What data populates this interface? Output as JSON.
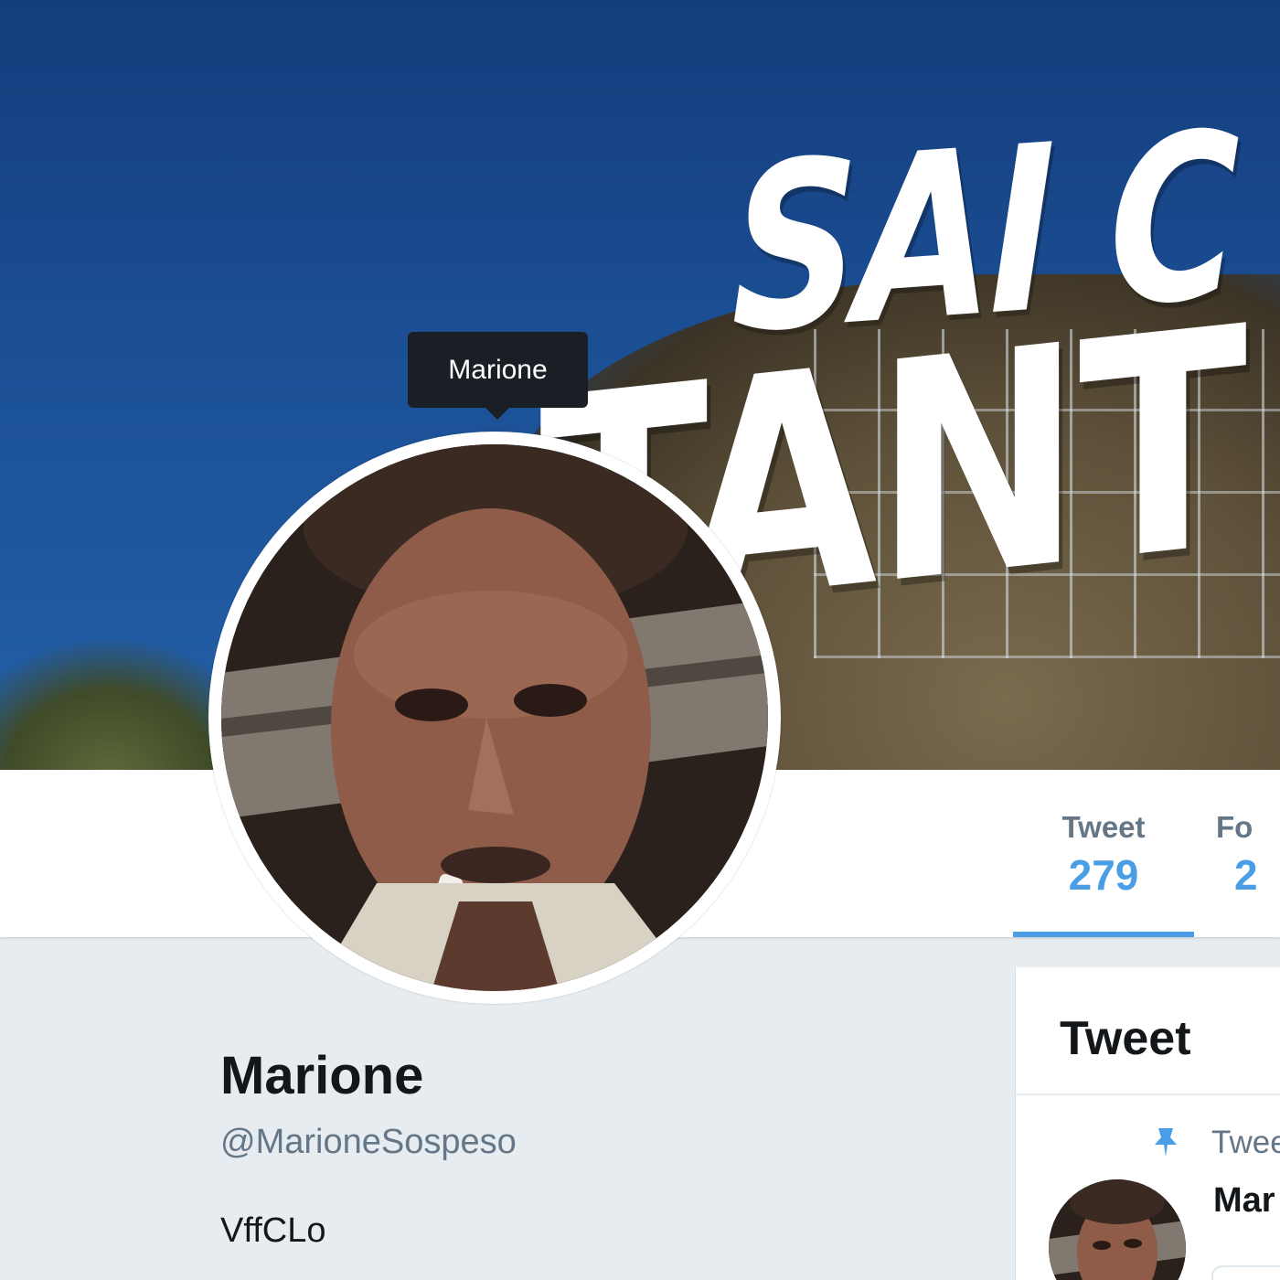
{
  "banner": {
    "line1": "SAI C",
    "line2": "TANT"
  },
  "tooltip": {
    "text": "Marione"
  },
  "stats": {
    "tweets": {
      "label": "Tweet",
      "value": "279",
      "active": true
    },
    "followers": {
      "label": "Fo",
      "value": "2"
    }
  },
  "profile": {
    "name": "Marione",
    "handle": "@MarioneSospeso",
    "bio": "VffCLo"
  },
  "timeline": {
    "title": "Tweet",
    "pinned_label": "Twee",
    "pinned_tweet": {
      "author": "Mar"
    }
  },
  "colors": {
    "accent": "#4a9ee6",
    "banner_blue": "#1b4f94",
    "page_background": "#e6ecf0",
    "tooltip_background": "#1a1f26"
  },
  "icons": {
    "pin": "pin-icon",
    "avatar": "avatar"
  }
}
